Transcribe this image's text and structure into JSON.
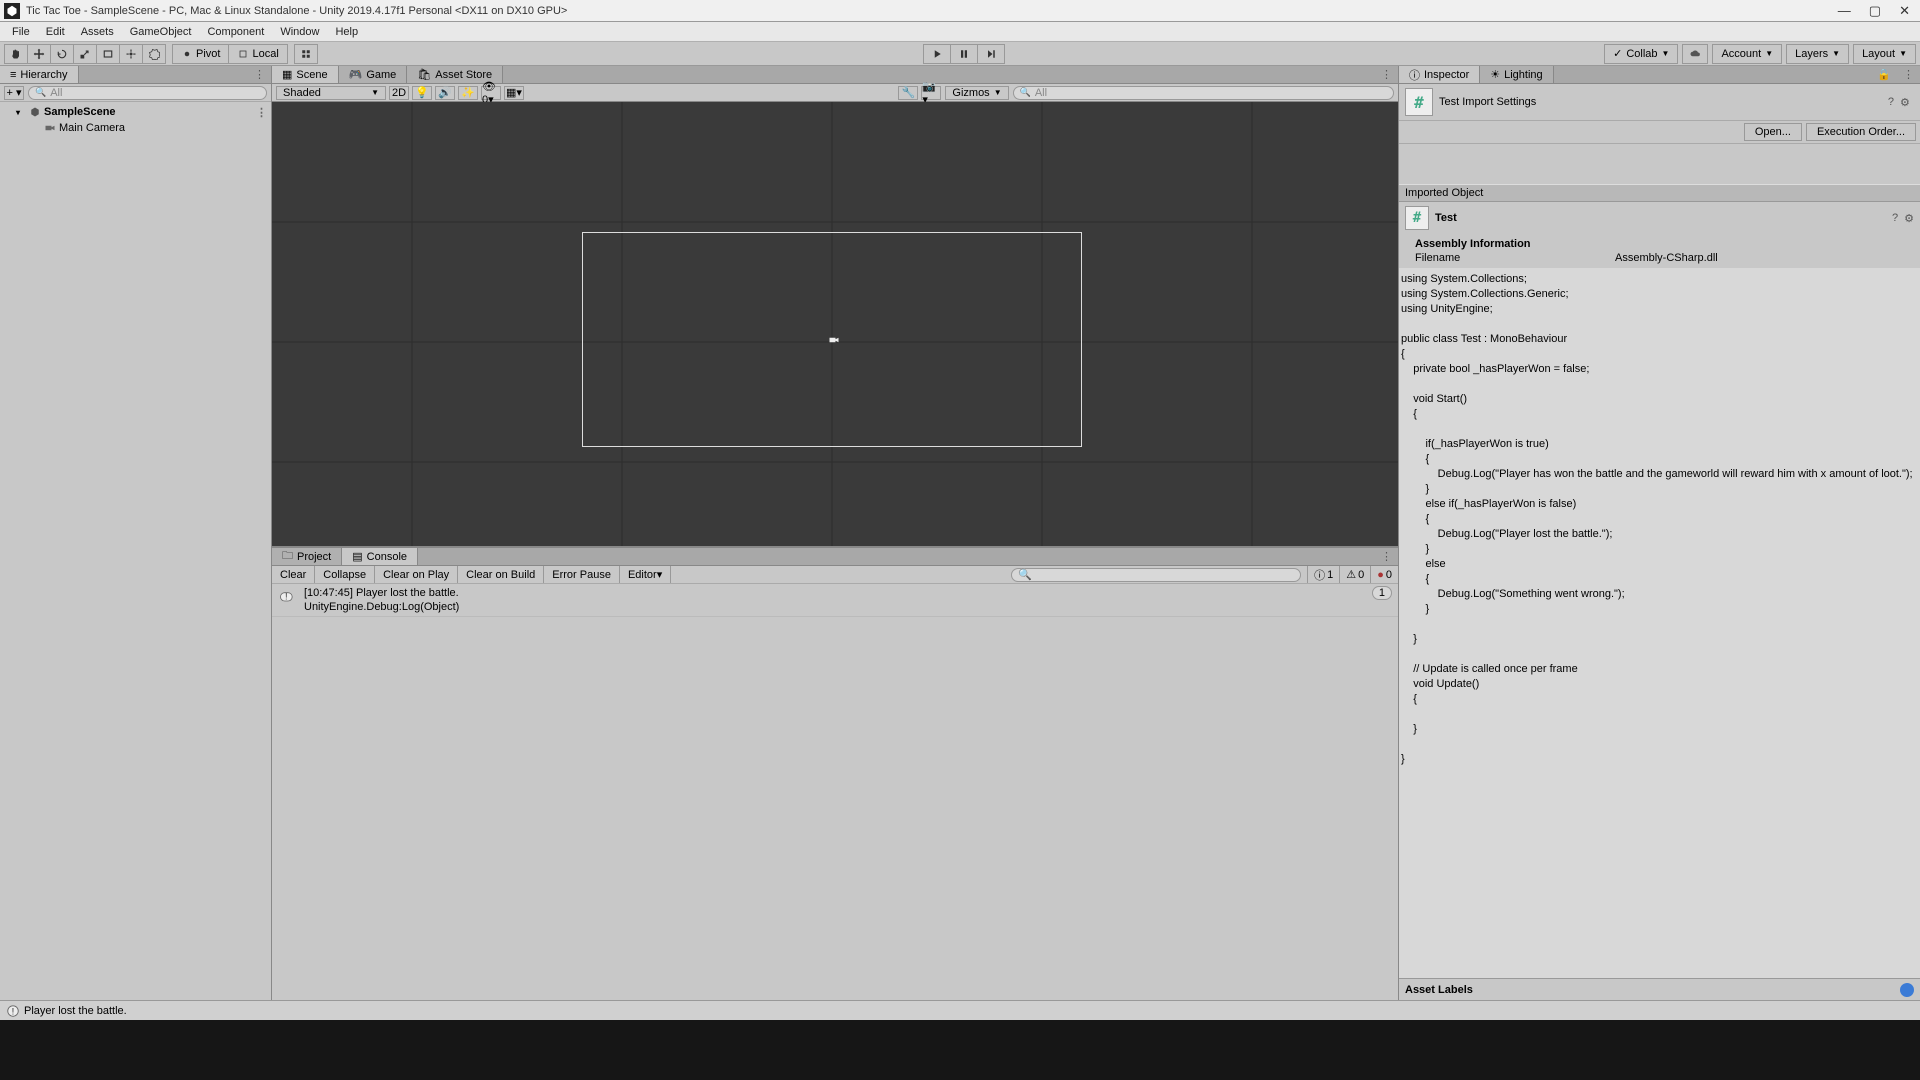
{
  "window": {
    "title": "Tic Tac Toe - SampleScene - PC, Mac & Linux Standalone - Unity 2019.4.17f1 Personal <DX11 on DX10 GPU>"
  },
  "menubar": [
    "File",
    "Edit",
    "Assets",
    "GameObject",
    "Component",
    "Window",
    "Help"
  ],
  "toolbar": {
    "pivot": "Pivot",
    "local": "Local",
    "collab": "Collab",
    "account": "Account",
    "layers": "Layers",
    "layout": "Layout"
  },
  "hierarchy": {
    "title": "Hierarchy",
    "search_placeholder": "All",
    "scene": "SampleScene",
    "items": [
      "Main Camera"
    ]
  },
  "scene_tabs": {
    "scene": "Scene",
    "game": "Game",
    "asset_store": "Asset Store"
  },
  "scene_toolbar": {
    "shading": "Shaded",
    "twod": "2D",
    "gizmos": "Gizmos",
    "search_placeholder": "All"
  },
  "bottom_tabs": {
    "project": "Project",
    "console": "Console"
  },
  "console": {
    "clear": "Clear",
    "collapse": "Collapse",
    "clear_play": "Clear on Play",
    "clear_build": "Clear on Build",
    "error_pause": "Error Pause",
    "editor": "Editor",
    "counts": {
      "info": "1",
      "warn": "0",
      "error": "0"
    },
    "entries": [
      {
        "line1": "[10:47:45] Player lost the battle.",
        "line2": "UnityEngine.Debug:Log(Object)",
        "count": "1"
      }
    ]
  },
  "inspector": {
    "tab": "Inspector",
    "lighting_tab": "Lighting",
    "header_title": "Test Import Settings",
    "open": "Open...",
    "exec_order": "Execution Order...",
    "imported": "Imported Object",
    "script_name": "Test",
    "asm_title": "Assembly Information",
    "filename_label": "Filename",
    "filename_value": "Assembly-CSharp.dll",
    "asset_labels": "Asset Labels",
    "code": "using System.Collections;\nusing System.Collections.Generic;\nusing UnityEngine;\n\npublic class Test : MonoBehaviour\n{\n    private bool _hasPlayerWon = false;\n\n    void Start()\n    {\n\n        if(_hasPlayerWon is true)\n        {\n            Debug.Log(\"Player has won the battle and the gameworld will reward him with x amount of loot.\");\n        }\n        else if(_hasPlayerWon is false)\n        {\n            Debug.Log(\"Player lost the battle.\");\n        }\n        else\n        {\n            Debug.Log(\"Something went wrong.\");\n        }\n\n    }\n\n    // Update is called once per frame\n    void Update()\n    {\n        \n    }\n\n}"
  },
  "statusbar": {
    "message": "Player lost the battle."
  }
}
